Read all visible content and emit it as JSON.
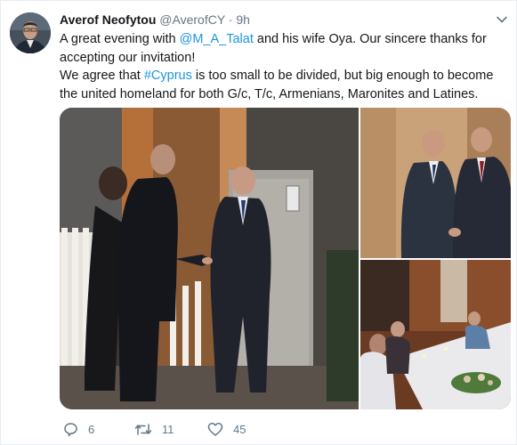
{
  "tweet": {
    "author_name": "Averof Neofytou",
    "handle": "@AverofCY",
    "separator": "·",
    "time": "9h",
    "line1_pre": "A great evening with ",
    "line1_mention": "@M_A_Talat",
    "line1_post": " and his wife Oya. Our sincere thanks for accepting our invitation!",
    "line2_pre": "We agree that ",
    "line2_hashtag": "#Cyprus",
    "line2_post": " is too small to be divided, but big enough to become the united homeland for both G/c, T/c, Armenians, Maronites and Latines."
  },
  "actions": {
    "replies": "6",
    "retweets": "11",
    "likes": "45"
  },
  "colors": {
    "link": "#1b95e0",
    "text": "#14171a",
    "muted": "#657786"
  },
  "icons": [
    "chevron-down-icon",
    "reply-icon",
    "retweet-icon",
    "like-icon"
  ]
}
